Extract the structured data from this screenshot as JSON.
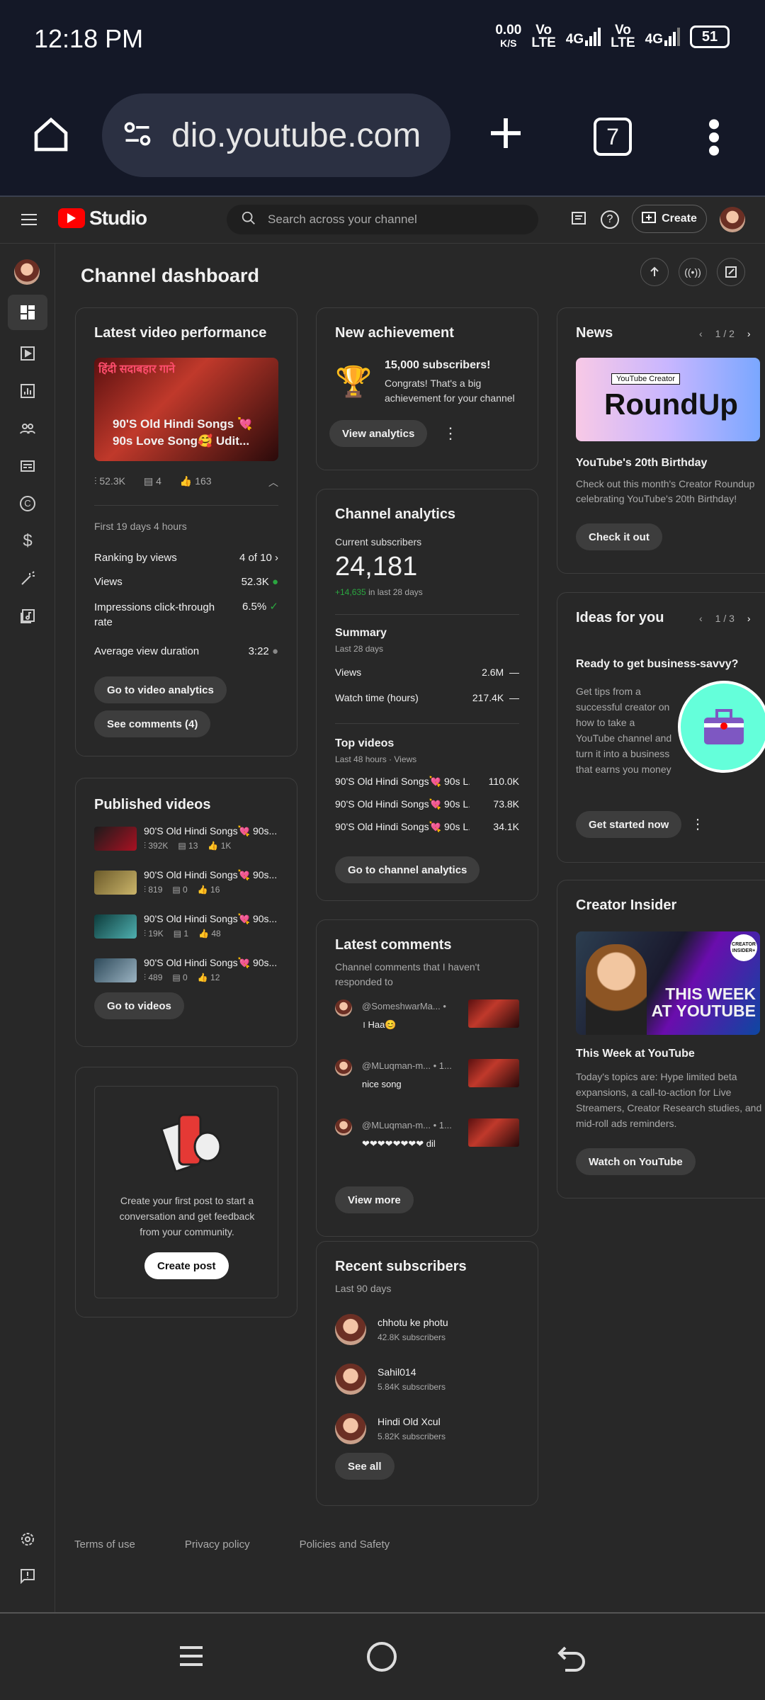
{
  "status": {
    "time": "12:18 PM",
    "speed": "0.00",
    "speed_unit": "K/S",
    "vo1": "Vo",
    "lte1": "LTE",
    "net1": "4G",
    "vo2": "Vo",
    "lte2": "LTE",
    "net2": "4G",
    "battery": "51"
  },
  "browser": {
    "url": "dio.youtube.com",
    "tab_count": "7"
  },
  "header": {
    "logo": "Studio",
    "search_placeholder": "Search across your channel",
    "create": "Create"
  },
  "page_title": "Channel dashboard",
  "latest_video": {
    "title": "Latest video performance",
    "thumb_text": "हिंदी सदाबहार गाने",
    "video_title": "90'S Old Hindi Songs 💘 90s Love Song🥰 Udit...",
    "views": "52.3K",
    "comments": "4",
    "likes": "163",
    "period": "First 19 days 4 hours",
    "ranking_label": "Ranking by views",
    "ranking_value": "4 of 10",
    "views_label": "Views",
    "views_value": "52.3K",
    "ctr_label": "Impressions click-through rate",
    "ctr_value": "6.5%",
    "avd_label": "Average view duration",
    "avd_value": "3:22",
    "btn_analytics": "Go to video analytics",
    "btn_comments": "See comments (4)"
  },
  "published": {
    "title": "Published videos",
    "items": [
      {
        "title": "90'S Old Hindi Songs💘 90s...",
        "views": "392K",
        "comments": "13",
        "likes": "1K"
      },
      {
        "title": "90'S Old Hindi Songs💘 90s...",
        "views": "819",
        "comments": "0",
        "likes": "16"
      },
      {
        "title": "90'S Old Hindi Songs💘 90s...",
        "views": "19K",
        "comments": "1",
        "likes": "48"
      },
      {
        "title": "90'S Old Hindi Songs💘 90s...",
        "views": "489",
        "comments": "0",
        "likes": "12"
      }
    ],
    "btn": "Go to videos"
  },
  "post": {
    "text": "Create your first post to start a conversation and get feedback from your community.",
    "btn": "Create post"
  },
  "achievement": {
    "title": "New achievement",
    "headline": "15,000 subscribers!",
    "body": "Congrats! That's a big achievement for your channel",
    "btn": "View analytics"
  },
  "analytics": {
    "title": "Channel analytics",
    "subs_label": "Current subscribers",
    "subs": "24,181",
    "subs_change": "+14,635",
    "subs_change_text": "in last 28 days",
    "summary": "Summary",
    "summary_period": "Last 28 days",
    "views_label": "Views",
    "views": "2.6M",
    "wt_label": "Watch time (hours)",
    "wt": "217.4K",
    "dash": "—",
    "top": "Top videos",
    "top_period": "Last 48 hours · Views",
    "top_items": [
      {
        "t": "90'S Old Hindi Songs💘 90s L...",
        "v": "110.0K"
      },
      {
        "t": "90'S Old Hindi Songs💘 90s L...",
        "v": "73.8K"
      },
      {
        "t": "90'S Old Hindi Songs💘 90s L...",
        "v": "34.1K"
      }
    ],
    "btn": "Go to channel analytics"
  },
  "comments": {
    "title": "Latest comments",
    "sub": "Channel comments that I haven't responded to",
    "items": [
      {
        "user": "@SomeshwarMa...",
        "meta": "•",
        "text": "। Haa😊"
      },
      {
        "user": "@MLuqman-m...",
        "meta": "• 1...",
        "text": "nice song"
      },
      {
        "user": "@MLuqman-m...",
        "meta": "• 1...",
        "text": "❤❤❤❤❤❤❤❤ dil"
      }
    ],
    "btn": "View more"
  },
  "subs": {
    "title": "Recent subscribers",
    "period": "Last 90 days",
    "items": [
      {
        "name": "chhotu ke photu",
        "count": "42.8K subscribers"
      },
      {
        "name": "Sahil014",
        "count": "5.84K subscribers"
      },
      {
        "name": "Hindi Old Xcul",
        "count": "5.82K subscribers"
      }
    ],
    "btn": "See all"
  },
  "news": {
    "title": "News",
    "pager": "1 / 2",
    "badge": "YouTube Creator",
    "img_text": "RoundUp",
    "headline": "YouTube's 20th Birthday",
    "body": "Check out this month's Creator Roundup celebrating YouTube's 20th Birthday!",
    "btn": "Check it out"
  },
  "ideas": {
    "title": "Ideas for you",
    "pager": "1 / 3",
    "headline": "Ready to get business-savvy?",
    "body": "Get tips from a successful creator on how to take a YouTube channel and turn it into a business that earns you money",
    "btn": "Get started now"
  },
  "insider": {
    "title": "Creator Insider",
    "badge": "CREATOR INSIDER+",
    "img_text": "THIS WEEK AT YOUTUBE",
    "headline": "This Week at YouTube",
    "body": "Today's topics are: Hype limited beta expansions, a call-to-action for Live Streamers, Creator Research studies, and mid-roll ads reminders.",
    "btn": "Watch on YouTube"
  },
  "footer": {
    "terms": "Terms of use",
    "privacy": "Privacy policy",
    "policies": "Policies and Safety"
  }
}
